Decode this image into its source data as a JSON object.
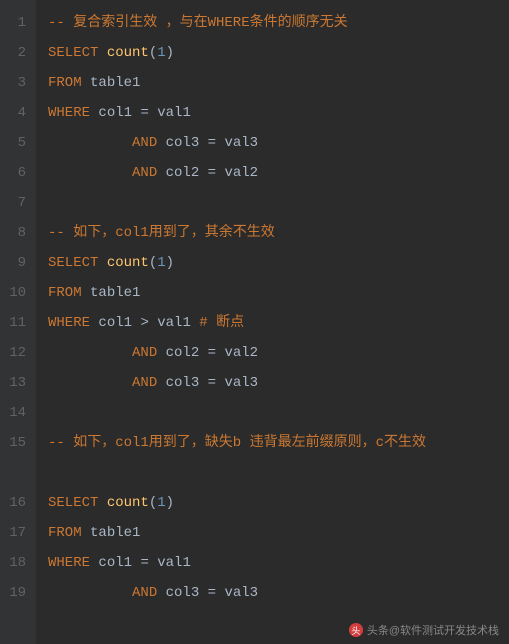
{
  "gutter": [
    "1",
    "2",
    "3",
    "4",
    "5",
    "6",
    "7",
    "8",
    "9",
    "10",
    "11",
    "12",
    "13",
    "14",
    "15",
    "16",
    "17",
    "18",
    "19"
  ],
  "lines": {
    "l1_comment": "-- 复合索引生效 ，与在WHERE条件的顺序无关",
    "l2_kw": "SELECT ",
    "l2_fn": "count",
    "l2_p1": "(",
    "l2_num": "1",
    "l2_p2": ")",
    "l3_kw": "FROM ",
    "l3_tbl": "table1",
    "l4_kw": "WHERE ",
    "l4_c": "col1 ",
    "l4_eq": "= ",
    "l4_v": "val1",
    "l5_pad": "          ",
    "l5_and": "AND ",
    "l5_c": "col3 ",
    "l5_eq": "= ",
    "l5_v": "val3",
    "l6_pad": "          ",
    "l6_and": "AND ",
    "l6_c": "col2 ",
    "l6_eq": "= ",
    "l6_v": "val2",
    "l8_comment": "-- 如下，col1用到了，其余不生效",
    "l9_kw": "SELECT ",
    "l9_fn": "count",
    "l9_p1": "(",
    "l9_num": "1",
    "l9_p2": ")",
    "l10_kw": "FROM ",
    "l10_tbl": "table1",
    "l11_kw": "WHERE ",
    "l11_c": "col1 ",
    "l11_op": "> ",
    "l11_v": "val1 ",
    "l11_cmt": "# 断点",
    "l12_pad": "          ",
    "l12_and": "AND ",
    "l12_c": "col2 ",
    "l12_eq": "= ",
    "l12_v": "val2",
    "l13_pad": "          ",
    "l13_and": "AND ",
    "l13_c": "col3 ",
    "l13_eq": "= ",
    "l13_v": "val3",
    "l15_comment": " -- 如下，col1用到了，缺失b 违背最左前缀原则，c不生效",
    "l16_kw": "SELECT ",
    "l16_fn": "count",
    "l16_p1": "(",
    "l16_num": "1",
    "l16_p2": ")",
    "l17_kw": "FROM ",
    "l17_tbl": "table1",
    "l18_kw": "WHERE ",
    "l18_c": "col1 ",
    "l18_eq": "= ",
    "l18_v": "val1",
    "l19_pad": "          ",
    "l19_and": "AND ",
    "l19_c": "col3 ",
    "l19_eq": "= ",
    "l19_v": "val3"
  },
  "watermark": {
    "icon": "头",
    "text": "头条@软件测试开发技术栈"
  }
}
